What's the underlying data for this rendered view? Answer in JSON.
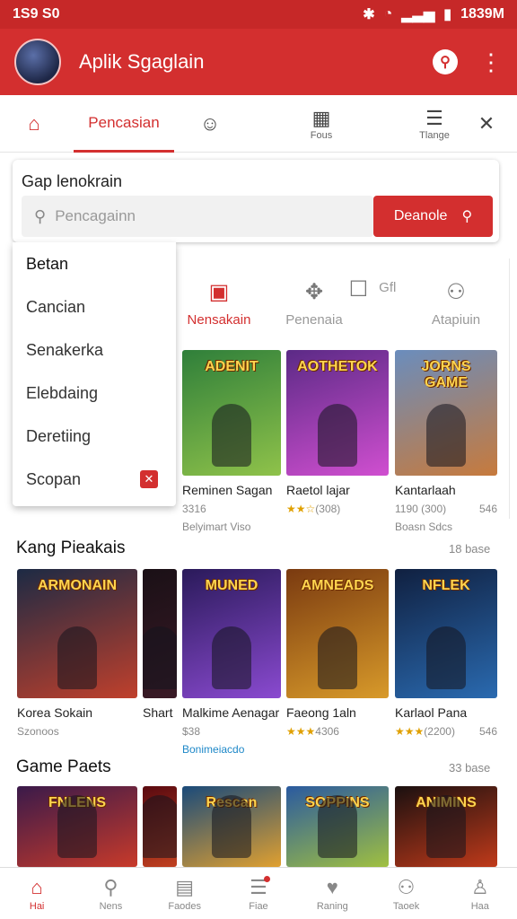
{
  "status": {
    "left": "1S9 S0",
    "right": "1839M"
  },
  "app": {
    "title": "Aplik Sgaglain",
    "accent": "#d32f2f"
  },
  "tabs": [
    {
      "label": "",
      "icon": "home-icon"
    },
    {
      "label": "Pencasian",
      "icon": "",
      "active": true
    },
    {
      "label": "",
      "icon": "chat-icon"
    },
    {
      "label": "Fous",
      "icon": "calendar-icon"
    },
    {
      "label": "Tlange",
      "icon": "menu-icon"
    },
    {
      "label": "",
      "icon": "close-icon"
    }
  ],
  "search": {
    "title": "Gap lenokrain",
    "placeholder": "Pencagainn",
    "button": "Deanole"
  },
  "dropdown": [
    "Betan",
    "Cancian",
    "Senakerka",
    "Elebdaing",
    "Deretiing",
    "Scopan"
  ],
  "subtabs": [
    {
      "label": "Nensakain",
      "icon": "calendar-icon",
      "active": true
    },
    {
      "label": "Penenaia",
      "icon": "puzzle-icon"
    },
    {
      "label": "Gfl",
      "icon": "square-icon"
    },
    {
      "label": "Atapiuin",
      "icon": "user-icon"
    }
  ],
  "row1": [
    {
      "caption": "ADENIT",
      "title": "Reminen Sagan",
      "sub": "3316",
      "sub2": "Belyimart Viso",
      "colors": [
        "#2f7f3a",
        "#8fc24a"
      ]
    },
    {
      "caption": "AOTHETOK",
      "title": "Raetol lajar",
      "sub": "(308)",
      "stars": "★★☆",
      "colors": [
        "#5b2a86",
        "#d04fd0"
      ]
    },
    {
      "caption": "JORNS GAME",
      "title": "Kantarlaah",
      "sub": "1190 (300)",
      "sub2": "Boasn Sdcs",
      "extra": "546",
      "colors": [
        "#6a8dbd",
        "#c77a3c"
      ]
    }
  ],
  "section2": {
    "title": "Kang Pieakais",
    "more": "18 base"
  },
  "row2": [
    {
      "caption": "ARMONAIN",
      "title": "Korea Sokain",
      "sub": "Szonoos",
      "colors": [
        "#1c2a44",
        "#c0402c"
      ]
    },
    {
      "caption": "",
      "title": "Shart",
      "sub": "",
      "colors": [
        "#1a1016",
        "#3a1a26"
      ]
    },
    {
      "caption": "MUNED",
      "title": "Malkime Aenagar",
      "sub": "$38",
      "sub2": "Bonimeiacdo",
      "colors": [
        "#2a1a5a",
        "#8a4ad0"
      ]
    },
    {
      "caption": "AMNEADS",
      "title": "Faeong 1aln",
      "sub": "4306",
      "stars": "★★★",
      "colors": [
        "#7a3a10",
        "#d89a2a"
      ]
    },
    {
      "caption": "NFLEK",
      "title": "Karlaol Pana",
      "sub": "(2200)",
      "stars": "★★★",
      "extra": "546",
      "colors": [
        "#102040",
        "#2a6ab0"
      ]
    }
  ],
  "section3": {
    "title": "Game Paets",
    "more": "33 base"
  },
  "row3": [
    {
      "caption": "FNLENS",
      "colors": [
        "#3a1a4a",
        "#c83a2a"
      ]
    },
    {
      "caption": "",
      "colors": [
        "#5a0a10",
        "#c04020"
      ]
    },
    {
      "caption": "Rescan",
      "colors": [
        "#1a4a7a",
        "#e0a030"
      ]
    },
    {
      "caption": "SOPPINS",
      "colors": [
        "#2a5aa0",
        "#a0c040"
      ]
    },
    {
      "caption": "ANIMINS",
      "colors": [
        "#1a1010",
        "#c03a1a"
      ]
    }
  ],
  "bottomnav": [
    {
      "label": "Hai",
      "icon": "home-icon",
      "active": true
    },
    {
      "label": "Nens",
      "icon": "search-icon"
    },
    {
      "label": "Faodes",
      "icon": "book-icon"
    },
    {
      "label": "Fiae",
      "icon": "list-icon"
    },
    {
      "label": "Raning",
      "icon": "heart-icon"
    },
    {
      "label": "Taoek",
      "icon": "profile-icon"
    },
    {
      "label": "Haa",
      "icon": "user-icon"
    }
  ]
}
